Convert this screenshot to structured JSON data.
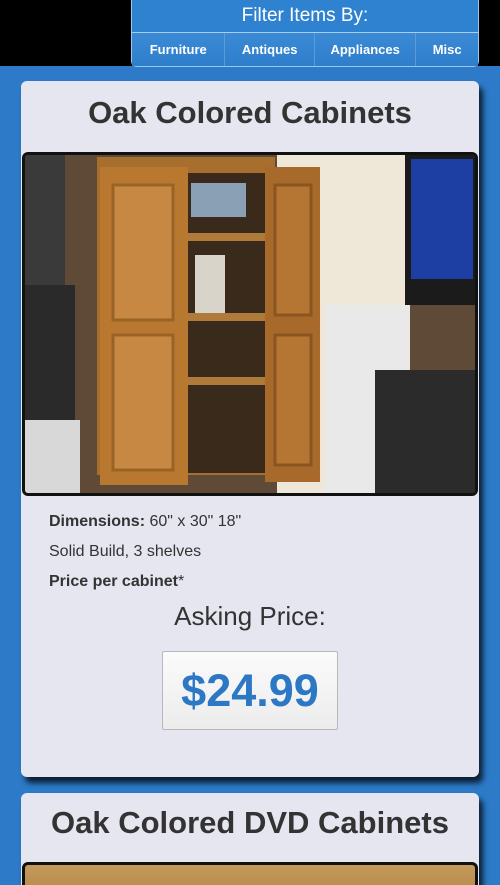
{
  "filter": {
    "title": "Filter Items By:",
    "buttons": [
      "Furniture",
      "Antiques",
      "Appliances",
      "Misc"
    ]
  },
  "items": [
    {
      "title": "Oak Colored Cabinets",
      "dimensions_label": "Dimensions:",
      "dimensions_value": "60\" x 30\" 18\"",
      "detail": "Solid Build, 3 shelves",
      "price_note": "Price per cabinet",
      "price_note_mark": "*",
      "asking_label": "Asking Price:",
      "price": "$24.99"
    },
    {
      "title": "Oak Colored DVD Cabinets"
    }
  ],
  "colors": {
    "page_background": "#2c7ac8",
    "card_background": "#e6e6f1",
    "price_text": "#2d78c4"
  }
}
